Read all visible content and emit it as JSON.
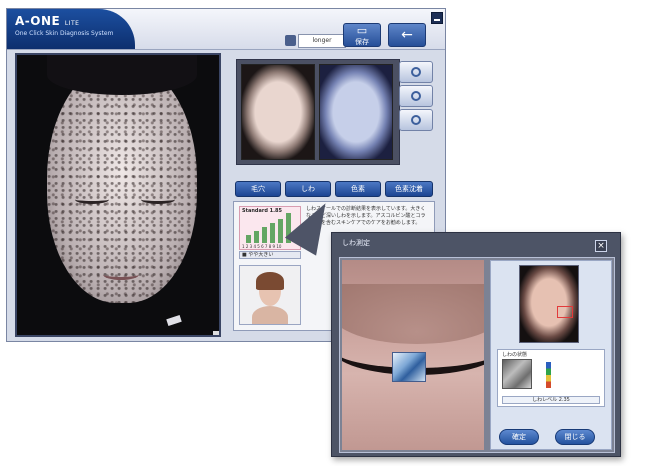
{
  "app": {
    "title": "A-ONE",
    "title_suffix": "LITE",
    "subtitle": "One Click Skin Diagnosis System"
  },
  "header": {
    "username": "longer",
    "btn_save_label": "保存",
    "btn_back_label": "←"
  },
  "menu": {
    "items": [
      "毛穴",
      "しわ",
      "色素",
      "色素沈着"
    ]
  },
  "info_panel": {
    "chart_title": "Standard 1.85",
    "chart_scale": "1 2 3 4 5 6 7 8 9 10",
    "chart_caption": "■ やや大きい",
    "bars": [
      8,
      12,
      16,
      20,
      24,
      30
    ],
    "description": "しわスケールでの診断結果を表示しています。大きくなるほど深いしわを示します。アスコルビン酸とコラーゲンを含むスキンケアでのケアをお勧めします。"
  },
  "popup": {
    "title": "しわ測定",
    "close_label": "×",
    "meter_title": "しわの状態",
    "meter_caption": "しわレベル 2.35",
    "btn_ok_label": "確定",
    "btn_close_label": "閉じる"
  },
  "colors": {
    "header_blue": "#1c4fa0",
    "button_blue": "#24529e",
    "window_bg": "#d5dbe8",
    "popup_bg": "#4d5466"
  }
}
